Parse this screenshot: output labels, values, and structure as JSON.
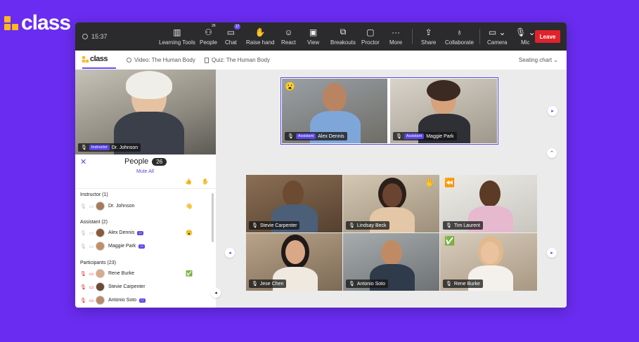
{
  "brand": {
    "name": "class"
  },
  "toolbar": {
    "timer": "15:37",
    "items": [
      {
        "label": "Learning Tools",
        "icon": "bars-icon"
      },
      {
        "label": "People",
        "icon": "people-icon",
        "badge": "26"
      },
      {
        "label": "Chat",
        "icon": "chat-icon",
        "badge": "17"
      },
      {
        "label": "Raise hand",
        "icon": "hand-icon"
      },
      {
        "label": "React",
        "icon": "smile-icon"
      },
      {
        "label": "View",
        "icon": "view-icon"
      },
      {
        "label": "Breakouts",
        "icon": "breakouts-icon"
      },
      {
        "label": "Proctor",
        "icon": "proctor-icon"
      },
      {
        "label": "More",
        "icon": "more-icon"
      },
      {
        "label": "Share",
        "icon": "share-icon"
      },
      {
        "label": "Collaborate",
        "icon": "bulb-icon"
      },
      {
        "label": "Camera",
        "icon": "camera-icon"
      },
      {
        "label": "Mic",
        "icon": "mic-icon"
      }
    ],
    "leave_label": "Leave"
  },
  "tabs": {
    "logo_text": "class",
    "video": "Video: The Human Body",
    "quiz": "Quiz: The Human Body",
    "seating": "Seating chart"
  },
  "instructor_tile": {
    "role": "Instructor",
    "name": "Dr. Johnson"
  },
  "top_row": [
    {
      "role": "Assistant",
      "name": "Alex Dennis",
      "emoji": "😮"
    },
    {
      "role": "Assistant",
      "name": "Maggie Park"
    }
  ],
  "grid": [
    {
      "name": "Stevie Carpenter"
    },
    {
      "name": "Lindsay Beck",
      "emoji": "✋"
    },
    {
      "name": "Tim Laurent",
      "emoji": "⏪"
    },
    {
      "name": "Jese Chen"
    },
    {
      "name": "Antonio Soto"
    },
    {
      "name": "Rene Burke",
      "emoji": "✅"
    }
  ],
  "people_panel": {
    "title": "People",
    "count": "26",
    "mute_all": "Mute All",
    "instructor_header": "Instructor (1)",
    "assistant_header": "Assistant (2)",
    "participants_header": "Participants (23)",
    "instructor": {
      "name": "Dr. Johnson",
      "status": "👋"
    },
    "assistants": [
      {
        "name": "Alex Dennis",
        "status": "😮"
      },
      {
        "name": "Maggie Park",
        "status": ""
      }
    ],
    "participants": [
      {
        "name": "Rene Burke",
        "status": "✅"
      },
      {
        "name": "Stevie Carpenter",
        "status": ""
      },
      {
        "name": "Antonio Soto",
        "status": ""
      }
    ]
  }
}
